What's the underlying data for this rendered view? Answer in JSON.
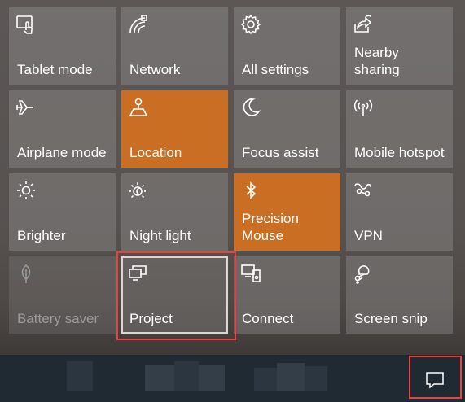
{
  "action_center": {
    "tiles": [
      {
        "label": "Tablet mode",
        "icon": "tablet-mode-icon",
        "state": "off"
      },
      {
        "label": "Network",
        "icon": "network-icon",
        "state": "off"
      },
      {
        "label": "All settings",
        "icon": "settings-gear-icon",
        "state": "off"
      },
      {
        "label": "Nearby sharing",
        "icon": "nearby-sharing-icon",
        "state": "off"
      },
      {
        "label": "Airplane mode",
        "icon": "airplane-icon",
        "state": "off"
      },
      {
        "label": "Location",
        "icon": "location-icon",
        "state": "on"
      },
      {
        "label": "Focus assist",
        "icon": "moon-icon",
        "state": "off"
      },
      {
        "label": "Mobile hotspot",
        "icon": "hotspot-icon",
        "state": "off"
      },
      {
        "label": "Brighter",
        "icon": "brightness-icon",
        "state": "off"
      },
      {
        "label": "Night light",
        "icon": "night-light-icon",
        "state": "off"
      },
      {
        "label": "Precision Mouse",
        "icon": "bluetooth-icon",
        "state": "on"
      },
      {
        "label": "VPN",
        "icon": "vpn-icon",
        "state": "off"
      },
      {
        "label": "Battery saver",
        "icon": "battery-saver-icon",
        "state": "disabled"
      },
      {
        "label": "Project",
        "icon": "project-icon",
        "state": "selected"
      },
      {
        "label": "Connect",
        "icon": "connect-icon",
        "state": "off"
      },
      {
        "label": "Screen snip",
        "icon": "screen-snip-icon",
        "state": "off"
      }
    ]
  },
  "taskbar": {
    "notification_icon": "notification-chat-icon"
  },
  "colors": {
    "accent": "#c96e23",
    "highlight": "#e8413e",
    "taskbar": "#1f2a33"
  }
}
